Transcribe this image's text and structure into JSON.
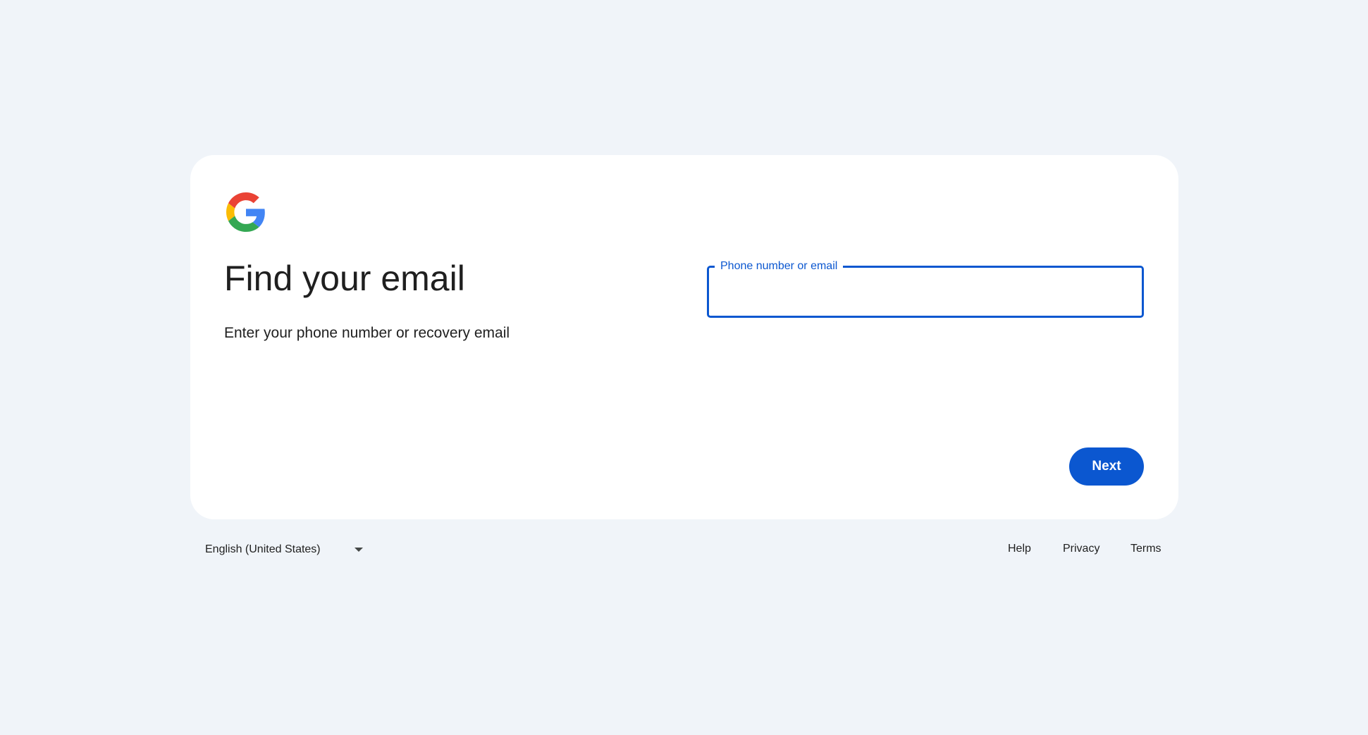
{
  "card": {
    "title": "Find your email",
    "subtitle": "Enter your phone number or recovery email",
    "field": {
      "label": "Phone number or email",
      "value": ""
    },
    "next_label": "Next"
  },
  "footer": {
    "language": "English (United States)",
    "links": [
      "Help",
      "Privacy",
      "Terms"
    ]
  },
  "colors": {
    "background": "#f0f4f9",
    "accent": "#0b57d0",
    "card": "#ffffff"
  },
  "icons": {
    "logo": "google-g-icon",
    "language_dropdown": "caret-down-icon"
  }
}
